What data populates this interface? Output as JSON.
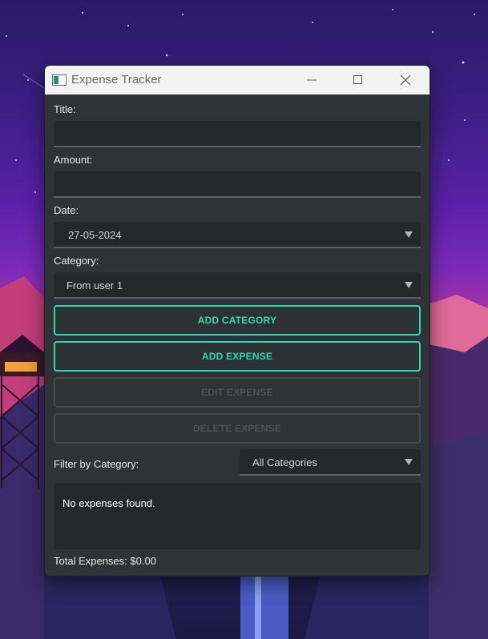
{
  "window": {
    "title": "Expense Tracker",
    "app_icon": "window-app-icon"
  },
  "form": {
    "title_label": "Title:",
    "title_value": "",
    "amount_label": "Amount:",
    "amount_value": "",
    "date_label": "Date:",
    "date_value": "27-05-2024",
    "category_label": "Category:",
    "category_value": "From user 1"
  },
  "buttons": {
    "add_category": "ADD CATEGORY",
    "add_expense": "ADD EXPENSE",
    "edit_expense": "EDIT EXPENSE",
    "delete_expense": "DELETE EXPENSE"
  },
  "filter": {
    "label": "Filter by Category:",
    "value": "All Categories"
  },
  "list": {
    "empty_message": "No expenses found."
  },
  "footer": {
    "total": "Total Expenses: $0.00"
  },
  "colors": {
    "accent": "#2fd8b3",
    "panel": "#2f3337",
    "field": "#25282b",
    "disabled": "#4d5156"
  }
}
